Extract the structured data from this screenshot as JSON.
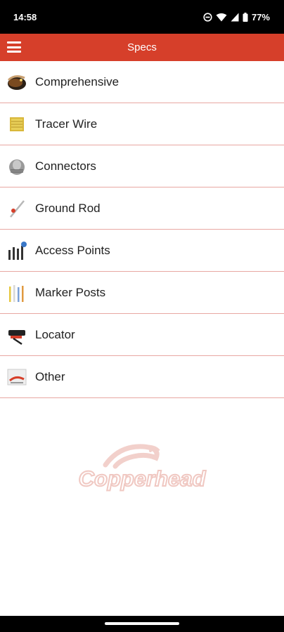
{
  "status_bar": {
    "time": "14:58",
    "battery": "77%"
  },
  "app_bar": {
    "title": "Specs"
  },
  "items": [
    {
      "label": "Comprehensive"
    },
    {
      "label": "Tracer Wire"
    },
    {
      "label": "Connectors"
    },
    {
      "label": "Ground Rod"
    },
    {
      "label": "Access Points"
    },
    {
      "label": "Marker Posts"
    },
    {
      "label": "Locator"
    },
    {
      "label": "Other"
    }
  ],
  "watermark": {
    "brand": "Copperhead"
  },
  "colors": {
    "accent": "#d63f2a",
    "divider": "#e8a7a2"
  }
}
